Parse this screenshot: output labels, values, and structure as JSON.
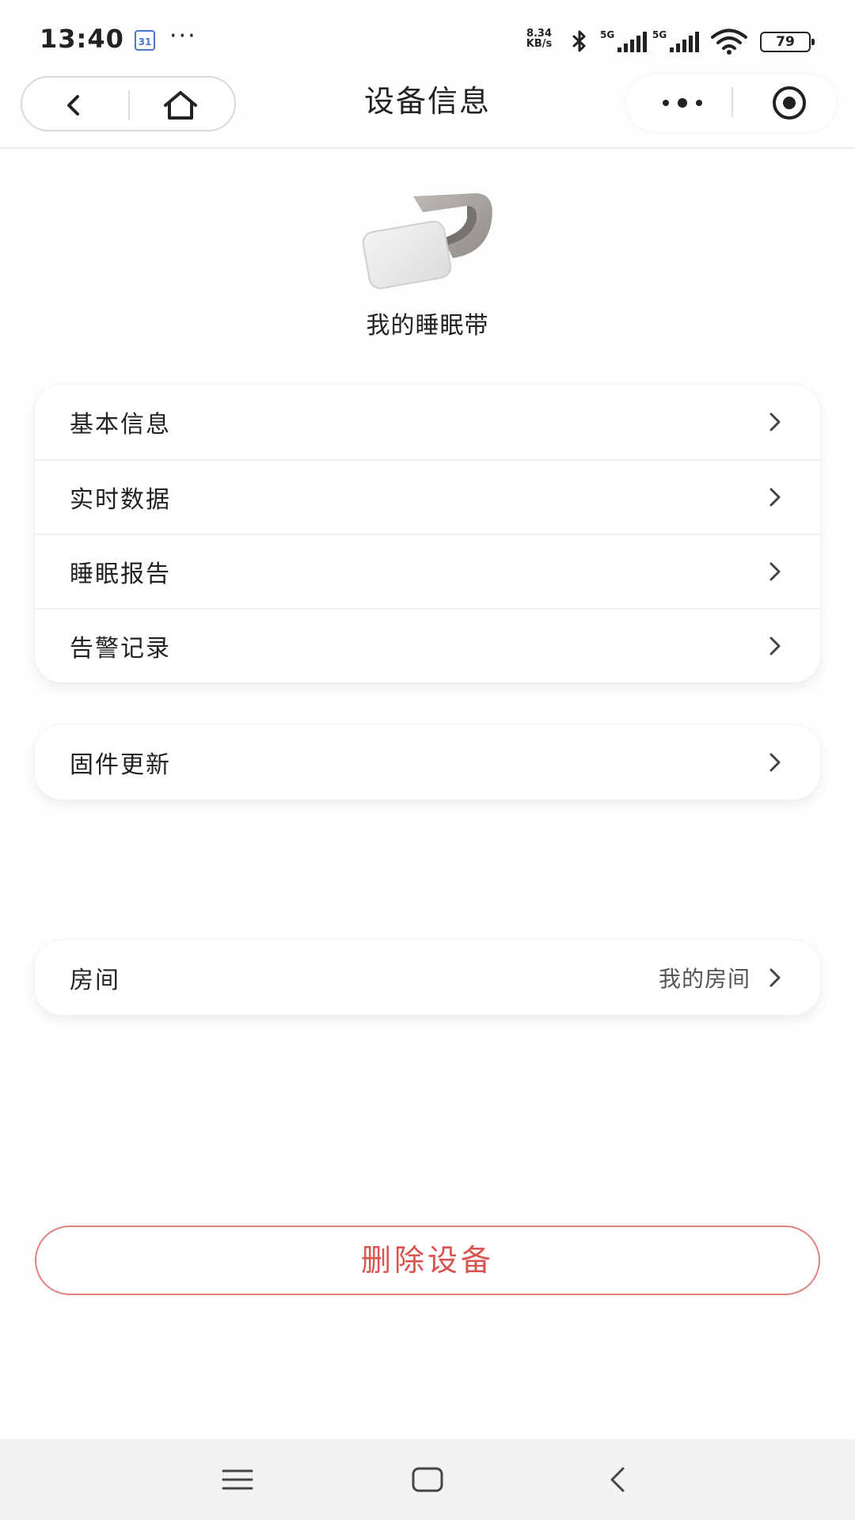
{
  "status_bar": {
    "time": "13:40",
    "calendar_badge": "31",
    "more": "···",
    "speed_value": "8.34",
    "speed_unit": "KB/s",
    "battery": "79"
  },
  "nav": {
    "title": "设备信息"
  },
  "device": {
    "name": "我的睡眠带"
  },
  "menu_group_1": [
    {
      "label": "基本信息"
    },
    {
      "label": "实时数据"
    },
    {
      "label": "睡眠报告"
    },
    {
      "label": "告警记录"
    }
  ],
  "menu_group_2": [
    {
      "label": "固件更新"
    }
  ],
  "room": {
    "label": "房间",
    "value": "我的房间"
  },
  "delete_button": {
    "label": "删除设备"
  },
  "colors": {
    "danger": "#d9534f",
    "danger_border": "#e08080",
    "text": "#222222",
    "sys_nav_bg": "#f2f2f2"
  }
}
